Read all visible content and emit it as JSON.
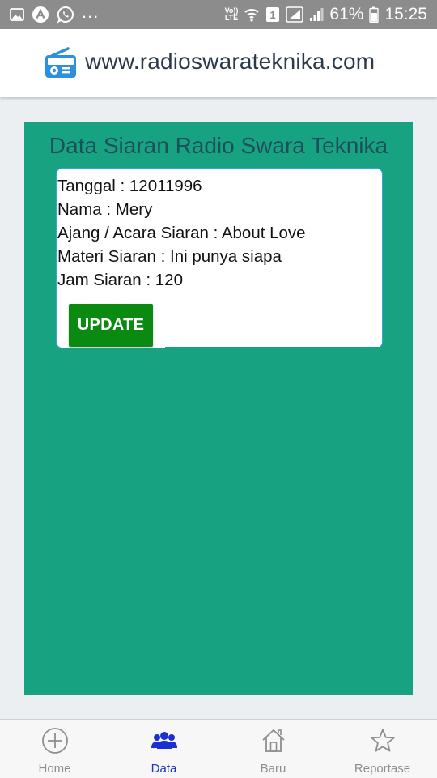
{
  "status_bar": {
    "dots": "...",
    "volte_top": "Vo))",
    "volte_bottom": "LTE",
    "sim_badge": "1",
    "battery": "61%",
    "time": "15:25"
  },
  "header": {
    "site_title": "www.radioswarateknika.com"
  },
  "main": {
    "title": "Data Siaran Radio Swara Teknika",
    "card": {
      "lines": [
        "Tanggal : 12011996",
        "Nama : Mery",
        "Ajang / Acara Siaran : About Love",
        "Materi Siaran : Ini punya siapa",
        "Jam Siaran : 120"
      ],
      "update_label": "UPDATE"
    }
  },
  "bottom_nav": {
    "tabs": [
      {
        "label": "Home",
        "icon": "plus-circle-icon"
      },
      {
        "label": "Data",
        "icon": "people-icon",
        "active": true
      },
      {
        "label": "Baru",
        "icon": "home-icon"
      },
      {
        "label": "Reportase",
        "icon": "star-icon"
      }
    ]
  },
  "colors": {
    "panel": "#17a382",
    "title_text": "#1d4f5b",
    "update_button": "#0b8a12",
    "active_tab": "#1a2fd4",
    "logo": "#2d8fde"
  }
}
